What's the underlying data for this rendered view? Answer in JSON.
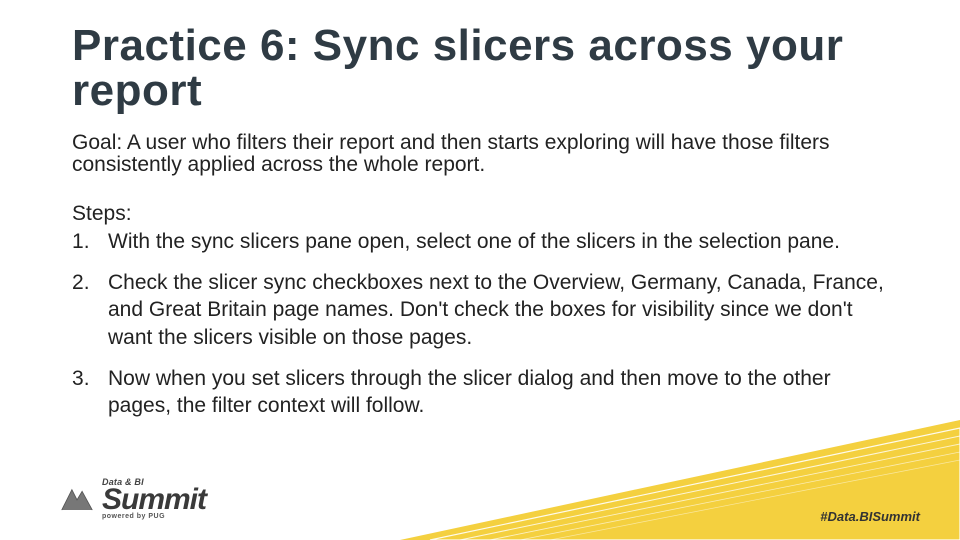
{
  "title": "Practice 6: Sync slicers across your report",
  "goal": "Goal: A user who filters their report and then starts exploring will have those filters consistently applied across the whole report.",
  "steps_label": "Steps:",
  "steps": [
    "With the sync slicers pane open, select one of the slicers in the selection pane.",
    "Check the slicer sync checkboxes next to the Overview, Germany, Canada, France, and Great Britain page names. Don't check the boxes for visibility since we don't want the slicers visible on those pages.",
    "Now when you set slicers through the slicer dialog and then move to the other pages, the filter context will follow."
  ],
  "logo": {
    "small": "Data & BI",
    "big": "Summit",
    "pug": "powered by PUG"
  },
  "hashtag": "#Data.BISummit",
  "colors": {
    "title": "#2f3b44",
    "accent": "#f1c40f"
  }
}
